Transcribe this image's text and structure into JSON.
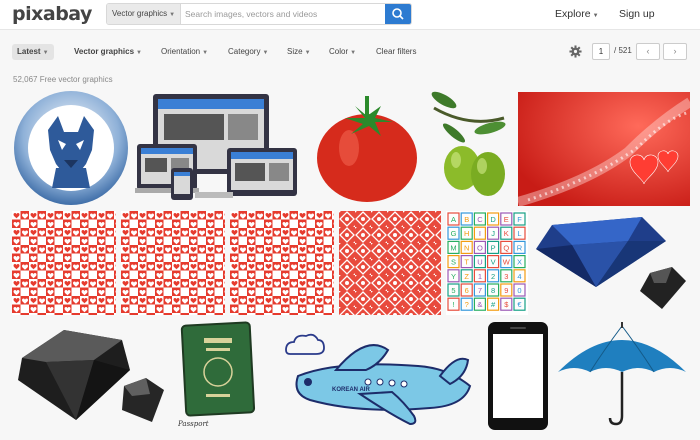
{
  "header": {
    "logo_text": "pixabay",
    "search_type": "Vector graphics",
    "search_placeholder": "Search images, vectors and videos",
    "explore_label": "Explore",
    "signup_label": "Sign up"
  },
  "filters": {
    "latest": "Latest",
    "vector_graphics": "Vector graphics",
    "orientation": "Orientation",
    "category": "Category",
    "size": "Size",
    "color": "Color",
    "clear": "Clear filters"
  },
  "pager": {
    "current": "1",
    "total": "/ 521",
    "prev": "‹",
    "next": "›"
  },
  "results_count": "52,067 Free vector graphics",
  "tiles": [
    {
      "name": "dog-emblem-image"
    },
    {
      "name": "responsive-devices-image"
    },
    {
      "name": "tomato-image"
    },
    {
      "name": "olives-image"
    },
    {
      "name": "red-hearts-sparkle-image"
    },
    {
      "name": "heart-pattern-1-image"
    },
    {
      "name": "heart-pattern-2-image"
    },
    {
      "name": "heart-pattern-3-image"
    },
    {
      "name": "red-geometric-pattern-image"
    },
    {
      "name": "alphabet-blocks-image"
    },
    {
      "name": "blue-diamond-image"
    },
    {
      "name": "black-diamonds-image"
    },
    {
      "name": "passport-image"
    },
    {
      "name": "airplane-image"
    },
    {
      "name": "smartphone-image"
    },
    {
      "name": "umbrella-image"
    }
  ],
  "passport_text": "Passport",
  "airplane_text": "KOREAN AIR",
  "alphabet": [
    "A",
    "B",
    "C",
    "D",
    "E",
    "F",
    "G",
    "H",
    "I",
    "J",
    "K",
    "L",
    "M",
    "N",
    "O",
    "P",
    "Q",
    "R",
    "S",
    "T",
    "U",
    "V",
    "W",
    "X",
    "Y",
    "Z",
    "1",
    "2",
    "3",
    "4",
    "5",
    "6",
    "7",
    "8",
    "9",
    "0",
    "!",
    "?",
    "&",
    "#",
    "$",
    "€"
  ],
  "colors": {
    "accent": "#2d7bd1",
    "heart_red": "#e63b2e"
  }
}
